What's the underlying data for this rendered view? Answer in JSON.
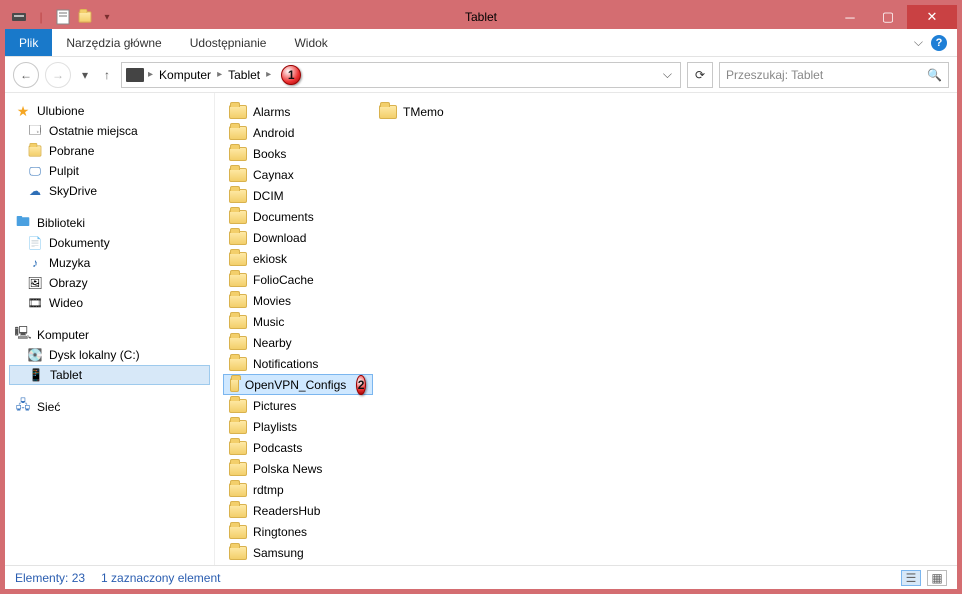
{
  "window": {
    "title": "Tablet"
  },
  "ribbon": {
    "file": "Plik",
    "tabs": [
      "Narzędzia główne",
      "Udostępnianie",
      "Widok"
    ]
  },
  "nav": {
    "crumbs": [
      "Komputer",
      "Tablet"
    ],
    "search_placeholder": "Przeszukaj: Tablet"
  },
  "sidebar": {
    "favorites": {
      "label": "Ulubione",
      "items": [
        "Ostatnie miejsca",
        "Pobrane",
        "Pulpit",
        "SkyDrive"
      ]
    },
    "libraries": {
      "label": "Biblioteki",
      "items": [
        "Dokumenty",
        "Muzyka",
        "Obrazy",
        "Wideo"
      ]
    },
    "computer": {
      "label": "Komputer",
      "items": [
        "Dysk lokalny (C:)",
        "Tablet"
      ]
    },
    "network": {
      "label": "Sieć"
    }
  },
  "folders_col1": [
    "Alarms",
    "Android",
    "Books",
    "Caynax",
    "DCIM",
    "Documents",
    "Download",
    "ekiosk",
    "FolioCache",
    "Movies",
    "Music",
    "Nearby",
    "Notifications",
    "OpenVPN_Configs",
    "Pictures",
    "Playlists",
    "Podcasts",
    "Polska News",
    "rdtmp",
    "ReadersHub",
    "Ringtones",
    "Samsung"
  ],
  "folders_col2": [
    "TMemo"
  ],
  "selected_folder": "OpenVPN_Configs",
  "status": {
    "count_label": "Elementy: 23",
    "sel_label": "1 zaznaczony element"
  },
  "annotations": {
    "a1": "1",
    "a2": "2"
  }
}
